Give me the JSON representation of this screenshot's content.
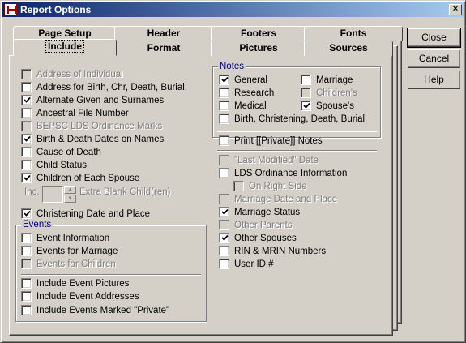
{
  "window": {
    "title": "Report Options",
    "close_glyph": "×"
  },
  "tabs": {
    "row_back": [
      "Page Setup",
      "Header",
      "Footers",
      "Fonts"
    ],
    "row_front": [
      "Include",
      "Format",
      "Pictures",
      "Sources"
    ],
    "active": "Include"
  },
  "buttons": {
    "close": "Close",
    "cancel": "Cancel",
    "help": "Help"
  },
  "left_options": [
    {
      "label": "Address of Individual",
      "checked": false,
      "disabled": true
    },
    {
      "label": "Address for Birth, Chr, Death, Burial.",
      "checked": false,
      "disabled": false
    },
    {
      "label": "Alternate Given and Surnames",
      "checked": true,
      "disabled": false
    },
    {
      "label": "Ancestral File Number",
      "checked": false,
      "disabled": false
    },
    {
      "label": "BEPSC LDS Ordinance Marks",
      "checked": false,
      "disabled": true
    },
    {
      "label": "Birth & Death Dates on Names",
      "checked": true,
      "disabled": false
    },
    {
      "label": "Cause of Death",
      "checked": false,
      "disabled": false
    },
    {
      "label": "Child Status",
      "checked": false,
      "disabled": false
    },
    {
      "label": "Children of Each Spouse",
      "checked": true,
      "disabled": false
    }
  ],
  "extra_blank": {
    "inc_label": "Inc.",
    "label": "Extra Blank Child(ren)"
  },
  "christening": {
    "label": "Christening Date and Place",
    "checked": true,
    "disabled": false
  },
  "events": {
    "title": "Events",
    "top": [
      {
        "label": "Event Information",
        "checked": false,
        "disabled": false
      },
      {
        "label": "Events for Marriage",
        "checked": false,
        "disabled": false
      },
      {
        "label": "Events for Children",
        "checked": false,
        "disabled": true
      }
    ],
    "bottom": [
      {
        "label": "Include Event Pictures",
        "checked": false,
        "disabled": false
      },
      {
        "label": "Include Event Addresses",
        "checked": false,
        "disabled": false
      },
      {
        "label": "Include Events Marked \"Private\"",
        "checked": false,
        "disabled": false
      }
    ]
  },
  "notes": {
    "title": "Notes",
    "left": [
      {
        "label": "General",
        "checked": true,
        "disabled": false
      },
      {
        "label": "Research",
        "checked": false,
        "disabled": false
      },
      {
        "label": "Medical",
        "checked": false,
        "disabled": false
      }
    ],
    "right": [
      {
        "label": "Marriage",
        "checked": false,
        "disabled": false
      },
      {
        "label": "Children's",
        "checked": false,
        "disabled": true
      },
      {
        "label": "Spouse's",
        "checked": true,
        "disabled": false
      }
    ],
    "bottom": {
      "label": "Birth, Christening, Death, Burial",
      "checked": false,
      "disabled": false
    }
  },
  "print_private": {
    "label": "Print [[Private]] Notes",
    "checked": false,
    "disabled": false
  },
  "right_options": [
    {
      "label": "\"Last Modified\" Date",
      "checked": false,
      "disabled": true
    },
    {
      "label": "LDS Ordinance Information",
      "checked": false,
      "disabled": false
    },
    {
      "label": "On Right Side",
      "checked": false,
      "disabled": true
    },
    {
      "label": "Marriage Date and Place",
      "checked": false,
      "disabled": true
    },
    {
      "label": "Marriage Status",
      "checked": true,
      "disabled": false
    },
    {
      "label": "Other Parents",
      "checked": false,
      "disabled": true
    },
    {
      "label": "Other Spouses",
      "checked": true,
      "disabled": false
    },
    {
      "label": "RIN & MRIN Numbers",
      "checked": false,
      "disabled": false
    },
    {
      "label": "User ID #",
      "checked": false,
      "disabled": false
    }
  ]
}
